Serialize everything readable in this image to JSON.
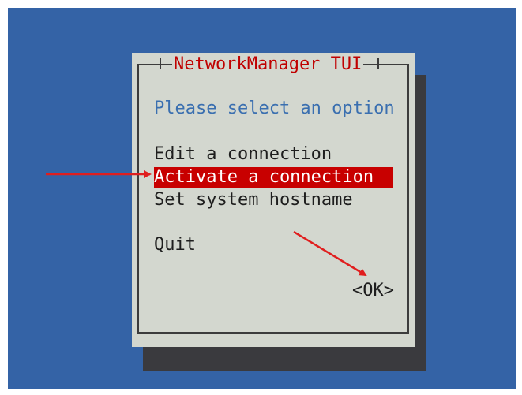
{
  "dialog": {
    "title": "NetworkManager TUI",
    "prompt": "Please select an option",
    "menu_items": [
      {
        "label": "Edit a connection",
        "selected": false
      },
      {
        "label": "Activate a connection",
        "selected": true
      },
      {
        "label": "Set system hostname",
        "selected": false
      }
    ],
    "quit_label": "Quit",
    "ok_label": "<OK>"
  },
  "colors": {
    "desktop": "#3463a6",
    "dialog_bg": "#d3d7cf",
    "title": "#c00000",
    "prompt": "#3a6fb0",
    "selection_bg": "#c80000",
    "annotation_arrow": "#e01e1e"
  }
}
